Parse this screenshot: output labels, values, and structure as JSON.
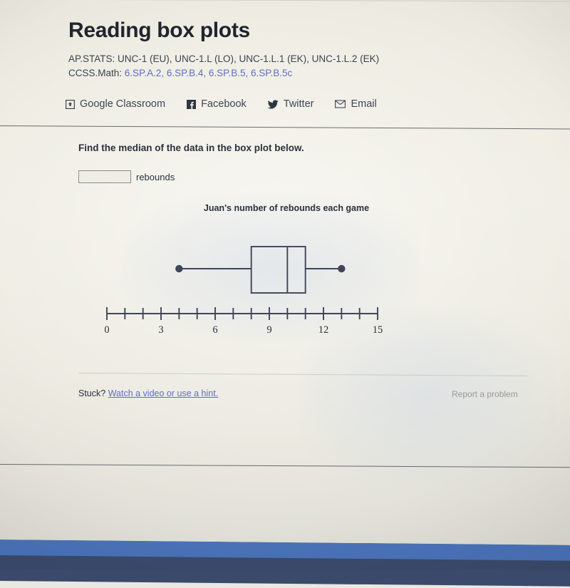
{
  "header": {
    "title": "Reading box plots",
    "ap_stats_label": "AP.STATS:",
    "ap_stats_value": "UNC-1 (EU), UNC-1.L (LO), UNC-1.L.1 (EK), UNC-1.L.2 (EK)",
    "ccss_label": "CCSS.Math:",
    "ccss_links": [
      "6.SP.A.2,",
      "6.SP.B.4,",
      "6.SP.B.5,",
      "6.SP.B.5c"
    ],
    "link_color": "#5f6fc3"
  },
  "share": {
    "items": [
      {
        "icon": "google-classroom-icon",
        "label": "Google Classroom"
      },
      {
        "icon": "facebook-icon",
        "label": "Facebook"
      },
      {
        "icon": "twitter-icon",
        "label": "Twitter"
      },
      {
        "icon": "email-icon",
        "label": "Email"
      }
    ]
  },
  "exercise": {
    "prompt": "Find the median of the data in the box plot below.",
    "answer_value": "",
    "answer_placeholder": "",
    "answer_unit": "rebounds"
  },
  "footer": {
    "stuck_label": "Stuck?",
    "hint_link": "Watch a video or use a hint.",
    "report_label": "Report a problem"
  },
  "chart_data": {
    "type": "box",
    "title": "Juan's number of rebounds each game",
    "xlabel": "",
    "ylabel": "",
    "xlim": [
      0,
      15
    ],
    "tick_step": 1,
    "labeled_ticks": [
      0,
      3,
      6,
      9,
      12,
      15
    ],
    "tick_labels": [
      "0",
      "3",
      "6",
      "9",
      "12",
      "15"
    ],
    "grid": false,
    "legend": "none",
    "series": [
      {
        "name": "Juan's rebounds",
        "min": 4,
        "q1": 8,
        "median": 10,
        "q3": 11,
        "max": 13,
        "whisker_endpoint_marker": "filled-circle"
      }
    ],
    "stroke_color": "#3f4558"
  }
}
